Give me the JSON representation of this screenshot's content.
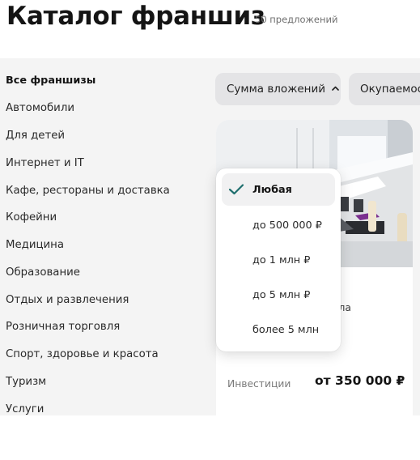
{
  "header": {
    "title": "Каталог франшиз",
    "offers_count": "50 предложений"
  },
  "sidebar": {
    "items": [
      {
        "label": "Все франшизы",
        "active": true
      },
      {
        "label": "Автомобили"
      },
      {
        "label": "Для детей"
      },
      {
        "label": "Интернет и IT"
      },
      {
        "label": "Кафе, рестораны и доставка"
      },
      {
        "label": "Кофейни"
      },
      {
        "label": "Медицина"
      },
      {
        "label": "Образование"
      },
      {
        "label": "Отдых и развлечения"
      },
      {
        "label": "Розничная торговля"
      },
      {
        "label": "Спорт, здоровье и красота"
      },
      {
        "label": "Туризм"
      },
      {
        "label": "Услуги"
      }
    ]
  },
  "filters": {
    "investment_label": "Сумма вложений",
    "payback_label": "Окупаемость"
  },
  "dropdown": {
    "options": [
      {
        "label": "Любая",
        "selected": true
      },
      {
        "label": "до 500 000 ₽"
      },
      {
        "label": "до 1 млн ₽"
      },
      {
        "label": "до 5 млн ₽"
      },
      {
        "label": "более 5 млн"
      }
    ]
  },
  "card": {
    "subtitle": "Международная школа программирования",
    "investment_label": "Инвестиции",
    "price": "от 350 000 ₽"
  },
  "colors": {
    "check": "#1f6f6e",
    "filter_bg": "#e4e4e6",
    "content_bg": "#f4f4f4",
    "accent_purple": "#7b2f8f"
  },
  "icons": {
    "chevron": "chevron-up-icon",
    "check": "check-icon"
  }
}
